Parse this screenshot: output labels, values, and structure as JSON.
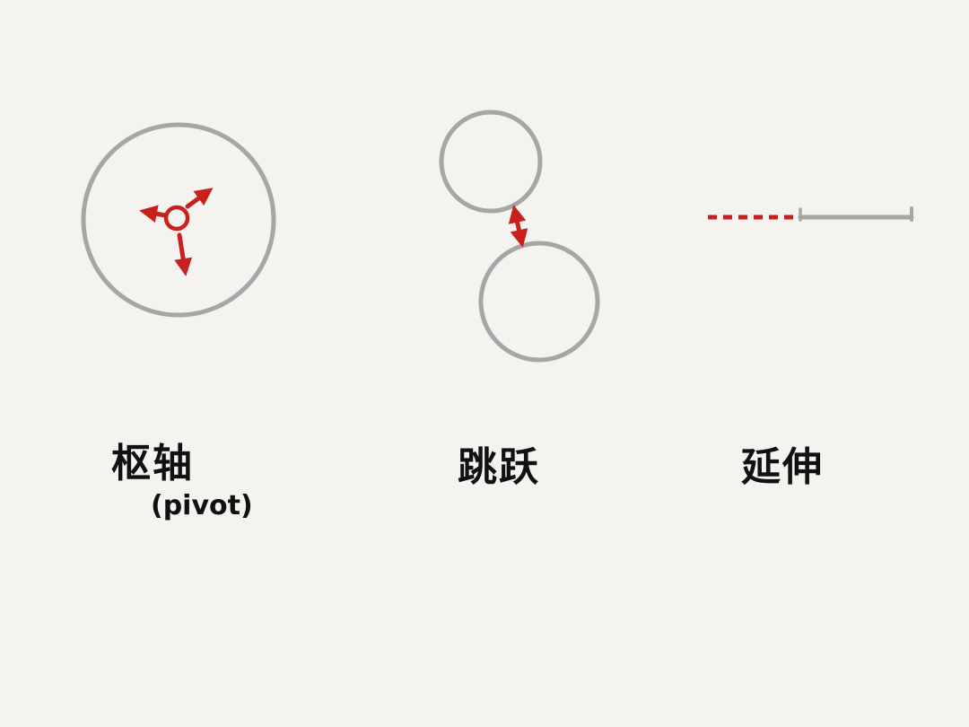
{
  "colors": {
    "background": "#f4f3f0",
    "outline_gray": "#a6a6a6",
    "accent_red": "#c8201c",
    "text": "#111111"
  },
  "labels": {
    "pivot": "枢轴",
    "pivot_sub": "(pivot)",
    "jump": "跳跃",
    "extend": "延伸"
  }
}
